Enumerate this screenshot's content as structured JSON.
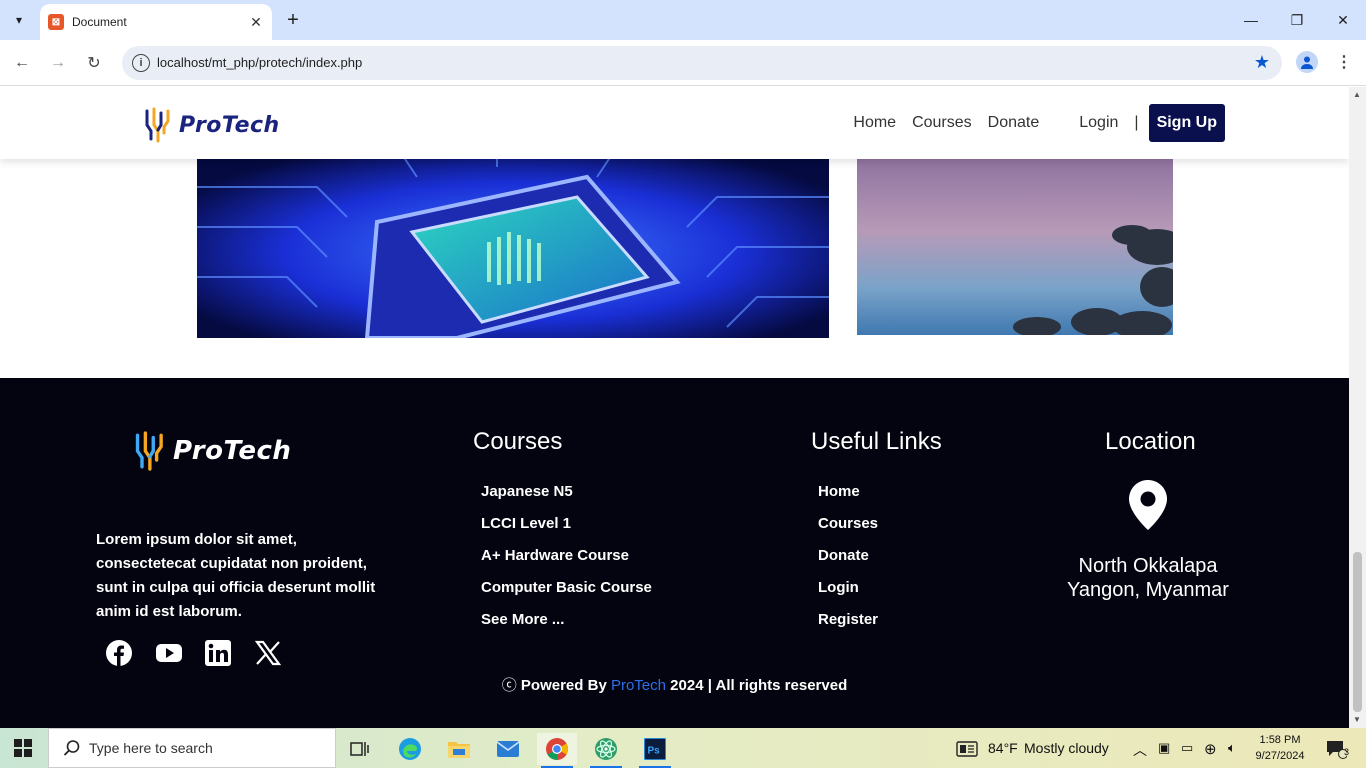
{
  "browser": {
    "tab_title": "Document",
    "url": "localhost/mt_php/protech/index.php"
  },
  "site": {
    "logo_text": "ProTech",
    "nav": {
      "home": "Home",
      "courses": "Courses",
      "donate": "Donate",
      "login": "Login",
      "separator": "|",
      "signup": "Sign Up"
    }
  },
  "footer": {
    "logo_text": "ProTech",
    "description": "Lorem ipsum dolor sit amet, consectetecat cupidatat non proident, sunt in culpa qui officia deserunt mollit anim id est laborum.",
    "courses": {
      "title": "Courses",
      "items": [
        "Japanese N5",
        "LCCI Level 1",
        "A+ Hardware Course",
        "Computer Basic Course",
        "See More ..."
      ]
    },
    "links": {
      "title": "Useful Links",
      "items": [
        "Home",
        "Courses",
        "Donate",
        "Login",
        "Register"
      ]
    },
    "location": {
      "title": "Location",
      "line1": "North Okkalapa",
      "line2": "Yangon, Myanmar"
    },
    "copyright": {
      "symbol": "ⓒ",
      "prefix": "Powered By",
      "brand": "ProTech",
      "suffix": "2024 | All rights reserved"
    },
    "social_icons": [
      "facebook-icon",
      "youtube-icon",
      "linkedin-icon",
      "x-icon"
    ]
  },
  "taskbar": {
    "search_placeholder": "Type here to search",
    "weather_temp": "84°F",
    "weather_desc": "Mostly cloudy",
    "time": "1:58 PM",
    "date": "9/27/2024",
    "notifications": "3"
  },
  "colors": {
    "nav_dark": "#0a0f4d",
    "footer_bg": "#03040f",
    "brand_blue": "#2f6fe8",
    "chrome_blue": "#d3e3fd"
  }
}
